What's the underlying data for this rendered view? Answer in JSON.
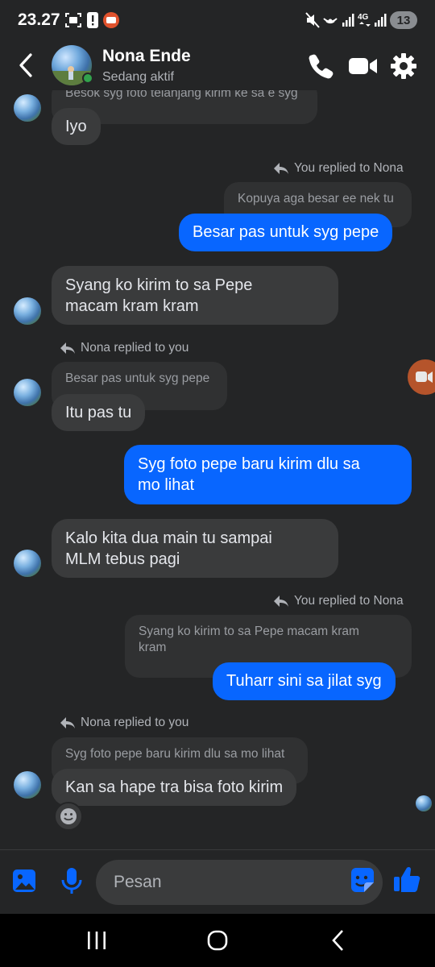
{
  "status_bar": {
    "time": "23.27",
    "battery": "13"
  },
  "header": {
    "name": "Nona Ende",
    "status": "Sedang aktif"
  },
  "messages": {
    "m0_text": "Iyo",
    "m0_quote": "Besok syg foto telanjang kirim ke sa e syg",
    "m1_note": "You replied to Nona",
    "m1_quote": "Kopuya aga besar ee nek tu",
    "m1_text": "Besar pas untuk syg pepe",
    "m2_line1": "Syang ko kirim to sa Pepe",
    "m2_line2": "macam kram kram",
    "m3_note": "Nona replied to you",
    "m3_quote": "Besar pas untuk syg pepe",
    "m3_text": "Itu pas tu",
    "m4_line1": "Syg foto pepe baru kirim dlu sa",
    "m4_line2": "mo lihat",
    "m5_line1": "Kalo kita dua main tu sampai",
    "m5_line2": "MLM tebus pagi",
    "m6_note": "You replied to Nona",
    "m6_quote_line1": "Syang ko kirim to sa Pepe macam kram",
    "m6_quote_line2": "kram",
    "m6_text": "Tuharr sini sa jilat syg",
    "m7_note": "Nona replied to you",
    "m7_quote": "Syg foto pepe baru kirim dlu sa mo lihat",
    "m7_text": "Kan sa hape tra bisa foto kirim"
  },
  "composer": {
    "placeholder": "Pesan"
  },
  "icons": {
    "back": "back-arrow-icon",
    "call": "phone-icon",
    "video": "video-camera-icon",
    "settings": "gear-icon",
    "gallery": "image-icon",
    "mic": "microphone-icon",
    "sticker": "sticker-icon",
    "like": "thumbs-up-icon",
    "react": "smiley-icon",
    "reply": "reply-arrow-icon"
  },
  "colors": {
    "accent": "#0866ff",
    "background": "#242526",
    "incoming_bubble": "#3a3b3c",
    "online": "#31a24c"
  }
}
